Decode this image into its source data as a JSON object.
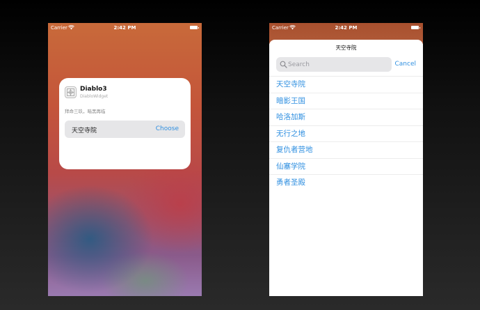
{
  "left_phone": {
    "status": {
      "carrier": "Carrier",
      "time": "2:42 PM"
    },
    "widget": {
      "title": "Diablo3",
      "subtitle": "DiabloWidget",
      "description": "拜命三玖，暗黑再临",
      "param_value": "天空寺院",
      "choose_label": "Choose"
    }
  },
  "right_phone": {
    "status": {
      "carrier": "Carrier",
      "time": "2:42 PM"
    },
    "sheet": {
      "title": "天空寺院",
      "search_placeholder": "Search",
      "cancel_label": "Cancel",
      "items": [
        "天空寺院",
        "暗影王国",
        "哈洛加斯",
        "无行之地",
        "复仇者营地",
        "仙塞学院",
        "勇者圣殿"
      ]
    }
  },
  "colors": {
    "accent": "#2f8fe0"
  }
}
